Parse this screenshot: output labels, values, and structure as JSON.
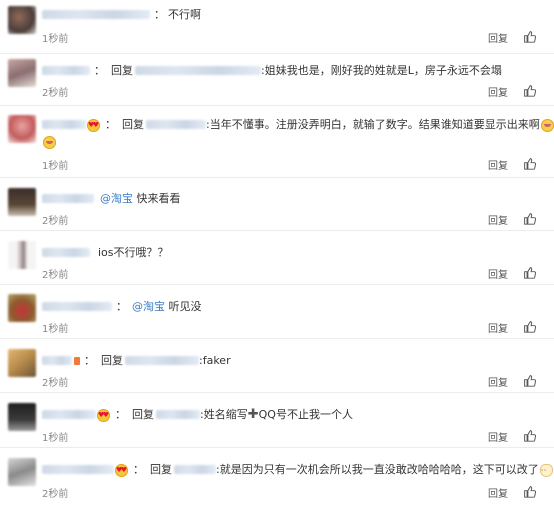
{
  "labels": {
    "reply_button": "回复",
    "reply_word": "回复",
    "separator": "："
  },
  "comments": [
    {
      "text": "不行啊",
      "time": "1秒前"
    },
    {
      "text": ":姐妹我也是，刚好我的姓就是L，房子永远不会塌",
      "time": "2秒前"
    },
    {
      "text": ":当年不懂事。注册没弄明白，就输了数字。结果谁知道要显示出来啊",
      "time": "1秒前"
    },
    {
      "mention": "@淘宝",
      "text": "快来看看",
      "time": "2秒前"
    },
    {
      "text": "ios不行哦？？",
      "time": "2秒前"
    },
    {
      "mention": "@淘宝",
      "text": "听见没",
      "time": "1秒前"
    },
    {
      "text": ":faker",
      "time": "2秒前"
    },
    {
      "text": ":姓名缩写",
      "text_b": "QQ号不止我一个人",
      "time": "1秒前"
    },
    {
      "text": ":就是因为只有一次机会所以我一直没敢改哈哈哈哈，这下可以改了",
      "time": "2秒前"
    }
  ],
  "icons": {
    "like": "thumbs-up-icon",
    "emoji_love": "heart-eyes-emoji-icon",
    "emoji_cry": "laughing-tears-emoji-icon",
    "emoji_face": "cute-face-emoji-icon",
    "plus": "heavy-plus-icon"
  },
  "colors": {
    "link": "#3b7cc7",
    "meta": "#888888",
    "divider": "#ececec"
  }
}
